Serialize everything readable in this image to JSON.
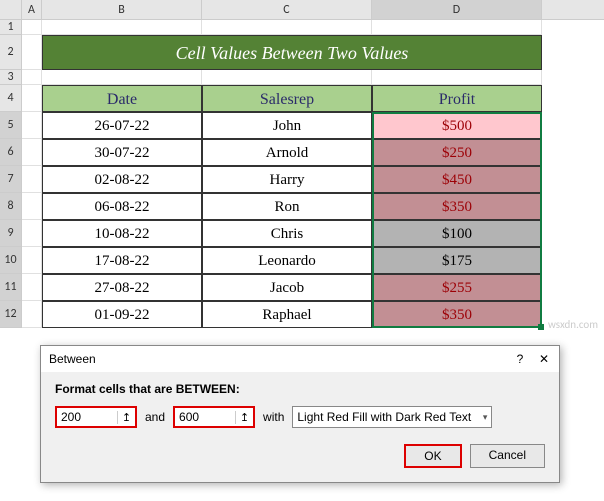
{
  "columns": [
    "A",
    "B",
    "C",
    "D"
  ],
  "rows": [
    "1",
    "2",
    "3",
    "4",
    "5",
    "6",
    "7",
    "8",
    "9",
    "10",
    "11",
    "12"
  ],
  "title": "Cell Values Between Two Values",
  "headers": {
    "date": "Date",
    "salesrep": "Salesrep",
    "profit": "Profit"
  },
  "data": [
    {
      "date": "26-07-22",
      "rep": "John",
      "profit": "$500",
      "hl": "light"
    },
    {
      "date": "30-07-22",
      "rep": "Arnold",
      "profit": "$250",
      "hl": "med"
    },
    {
      "date": "02-08-22",
      "rep": "Harry",
      "profit": "$450",
      "hl": "med"
    },
    {
      "date": "06-08-22",
      "rep": "Ron",
      "profit": "$350",
      "hl": "med"
    },
    {
      "date": "10-08-22",
      "rep": "Chris",
      "profit": "$100",
      "hl": "none"
    },
    {
      "date": "17-08-22",
      "rep": "Leonardo",
      "profit": "$175",
      "hl": "none"
    },
    {
      "date": "27-08-22",
      "rep": "Jacob",
      "profit": "$255",
      "hl": "med"
    },
    {
      "date": "01-09-22",
      "rep": "Raphael",
      "profit": "$350",
      "hl": "med"
    }
  ],
  "dialog": {
    "title": "Between",
    "help": "?",
    "close": "✕",
    "subtitle": "Format cells that are BETWEEN:",
    "val1": "200",
    "and": "and",
    "val2": "600",
    "with": "with",
    "format_option": "Light Red Fill with Dark Red Text",
    "ok": "OK",
    "cancel": "Cancel"
  },
  "watermark": "wsxdn.com"
}
